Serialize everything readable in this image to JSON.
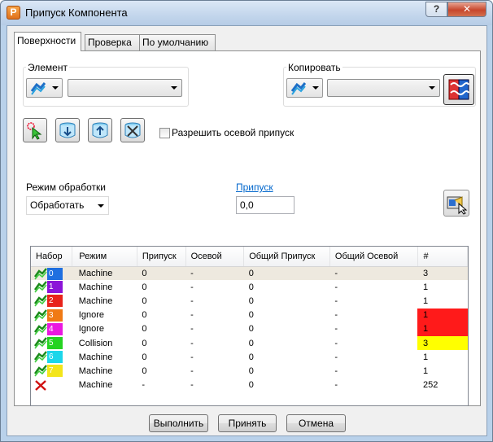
{
  "window": {
    "title": "Припуск Компонента",
    "help_label": "?",
    "close_label": "✕",
    "app_icon_letter": "P"
  },
  "tabs": [
    {
      "label": "Поверхности",
      "active": true
    },
    {
      "label": "Проверка",
      "active": false
    },
    {
      "label": "По умолчанию",
      "active": false
    }
  ],
  "element": {
    "label": "Элемент",
    "combo_value": ""
  },
  "copy": {
    "label": "Копировать",
    "combo_value": ""
  },
  "toolbar": {
    "axial_allowance_checkbox_label": "Разрешить осевой припуск",
    "axial_allowance_checked": false
  },
  "mode": {
    "label": "Режим обработки",
    "value": "Обработать"
  },
  "allowance": {
    "label": "Припуск",
    "value": "0,0"
  },
  "table": {
    "headers": [
      "Набор",
      "Режим",
      "Припуск",
      "Осевой",
      "Общий Припуск",
      "Общий Осевой",
      "#"
    ],
    "rows": [
      {
        "set": "0",
        "color": "#1f6fe0",
        "mode": "Machine",
        "allowance": "0",
        "axial": "-",
        "total": "0",
        "total_axial": "-",
        "count": "3",
        "count_bg": "",
        "selected": true
      },
      {
        "set": "1",
        "color": "#8b14d8",
        "mode": "Machine",
        "allowance": "0",
        "axial": "-",
        "total": "0",
        "total_axial": "-",
        "count": "1",
        "count_bg": "",
        "selected": false
      },
      {
        "set": "2",
        "color": "#e8231b",
        "mode": "Machine",
        "allowance": "0",
        "axial": "-",
        "total": "0",
        "total_axial": "-",
        "count": "1",
        "count_bg": "",
        "selected": false
      },
      {
        "set": "3",
        "color": "#f07a14",
        "mode": "Ignore",
        "allowance": "0",
        "axial": "-",
        "total": "0",
        "total_axial": "-",
        "count": "1",
        "count_bg": "#ff1a1a",
        "selected": false
      },
      {
        "set": "4",
        "color": "#ea18e0",
        "mode": "Ignore",
        "allowance": "0",
        "axial": "-",
        "total": "0",
        "total_axial": "-",
        "count": "1",
        "count_bg": "#ff1a1a",
        "selected": false
      },
      {
        "set": "5",
        "color": "#25d321",
        "mode": "Collision",
        "allowance": "0",
        "axial": "-",
        "total": "0",
        "total_axial": "-",
        "count": "3",
        "count_bg": "#ffff00",
        "selected": false
      },
      {
        "set": "6",
        "color": "#1cd6ea",
        "mode": "Machine",
        "allowance": "0",
        "axial": "-",
        "total": "0",
        "total_axial": "-",
        "count": "1",
        "count_bg": "",
        "selected": false
      },
      {
        "set": "7",
        "color": "#f3e51a",
        "mode": "Machine",
        "allowance": "0",
        "axial": "-",
        "total": "0",
        "total_axial": "-",
        "count": "1",
        "count_bg": "",
        "selected": false
      },
      {
        "set": "",
        "color": "",
        "mode": "Machine",
        "allowance": "-",
        "axial": "-",
        "total": "0",
        "total_axial": "-",
        "count": "252",
        "count_bg": "",
        "selected": false,
        "unassigned": true
      }
    ]
  },
  "buttons": {
    "execute": "Выполнить",
    "accept": "Принять",
    "cancel": "Отмена"
  }
}
